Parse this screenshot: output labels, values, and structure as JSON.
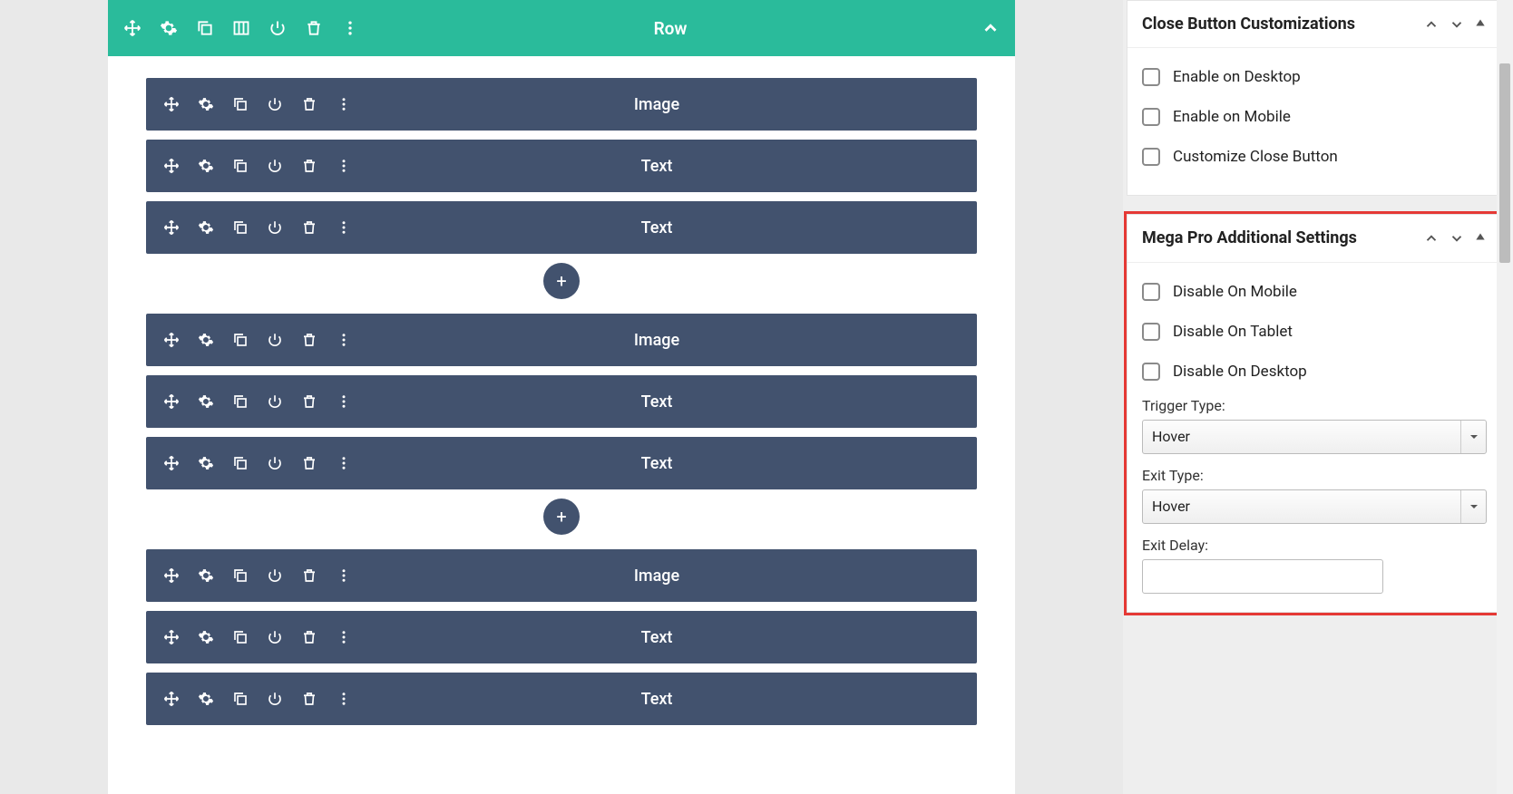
{
  "builder": {
    "row_title": "Row",
    "groups": [
      {
        "elements": [
          "Image",
          "Text",
          "Text"
        ]
      },
      {
        "elements": [
          "Image",
          "Text",
          "Text"
        ]
      },
      {
        "elements": [
          "Image",
          "Text",
          "Text"
        ]
      }
    ]
  },
  "sidebar": {
    "panels": {
      "close_button": {
        "title": "Close Button Customizations",
        "options": {
          "enable_desktop": "Enable on Desktop",
          "enable_mobile": "Enable on Mobile",
          "customize": "Customize Close Button"
        }
      },
      "mega_pro": {
        "title": "Mega Pro Additional Settings",
        "options": {
          "disable_mobile": "Disable On Mobile",
          "disable_tablet": "Disable On Tablet",
          "disable_desktop": "Disable On Desktop"
        },
        "trigger_type_label": "Trigger Type:",
        "trigger_type_value": "Hover",
        "exit_type_label": "Exit Type:",
        "exit_type_value": "Hover",
        "exit_delay_label": "Exit Delay:",
        "exit_delay_value": ""
      }
    }
  }
}
